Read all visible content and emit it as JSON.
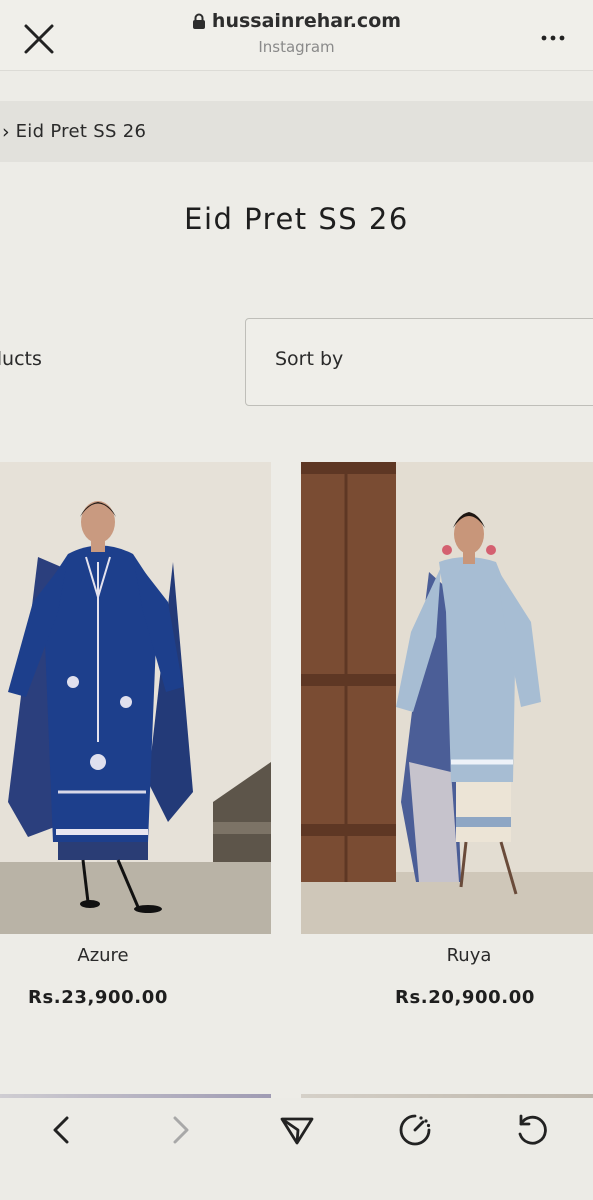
{
  "browser": {
    "domain": "hussainrehar.com",
    "source": "Instagram"
  },
  "breadcrumb": {
    "current": "Eid Pret SS 26"
  },
  "page": {
    "title": "Eid Pret SS 26"
  },
  "filters": {
    "products_label": "ducts",
    "sort_label": "Sort by"
  },
  "products": [
    {
      "name": "Azure",
      "price": "Rs.23,900.00"
    },
    {
      "name": "Ruya",
      "price": "Rs.20,900.00"
    }
  ],
  "icons": {
    "close": "close-icon",
    "lock": "lock-icon",
    "more": "more-icon",
    "back": "chevron-left-icon",
    "forward": "chevron-right-icon",
    "share": "send-icon",
    "speed": "gauge-icon",
    "reload": "reload-icon"
  }
}
